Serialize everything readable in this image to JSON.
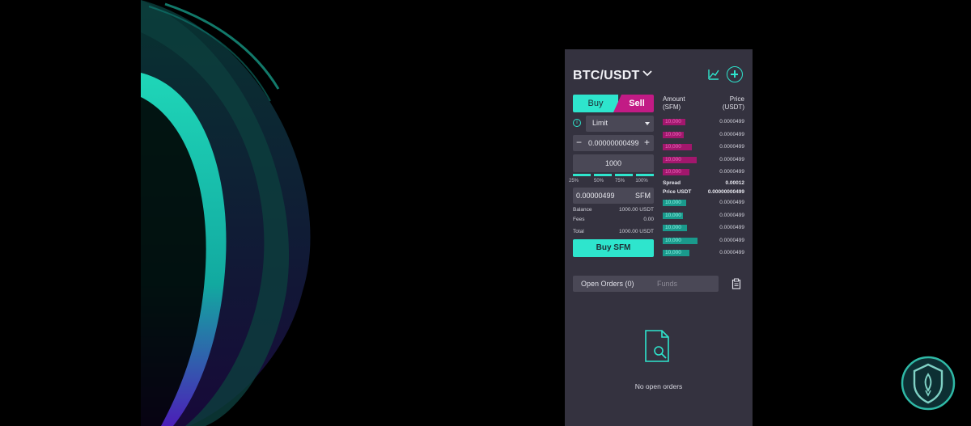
{
  "trade": {
    "pair": "BTC/USDT",
    "tabs": {
      "buy": "Buy",
      "sell": "Sell"
    },
    "order_type": "Limit",
    "price_value": "0.00000000499",
    "quantity_value": "1000",
    "percent_options": [
      "25%",
      "50%",
      "75%",
      "100%"
    ],
    "total_value": "0.00000499",
    "total_unit": "SFM",
    "balance_label": "Balance",
    "balance_value": "1000.00 USDT",
    "fees_label": "Fees",
    "fees_value": "0.00",
    "total_label": "Total",
    "total_amount": "1000.00 USDT",
    "buy_button": "Buy SFM"
  },
  "orderbook": {
    "amount_header": [
      "Amount",
      "(SFM)"
    ],
    "price_header": [
      "Price",
      "(USDT)"
    ],
    "asks": [
      {
        "amount": "10,000",
        "price": "0.0000499",
        "depth": 0.28
      },
      {
        "amount": "10,000",
        "price": "0.0000499",
        "depth": 0.26
      },
      {
        "amount": "10,000",
        "price": "0.0000499",
        "depth": 0.36
      },
      {
        "amount": "10,000",
        "price": "0.0000499",
        "depth": 0.42
      },
      {
        "amount": "10,000",
        "price": "0.0000499",
        "depth": 0.33
      }
    ],
    "spread_label": "Spread",
    "spread_value": "0.00012",
    "price_usdt_label": "Price USDT",
    "price_usdt_value": "0.00000000499",
    "bids": [
      {
        "amount": "10,000",
        "price": "0.0000499",
        "depth": 0.29
      },
      {
        "amount": "10,000",
        "price": "0.0000499",
        "depth": 0.25
      },
      {
        "amount": "10,000",
        "price": "0.0000499",
        "depth": 0.3
      },
      {
        "amount": "10,000",
        "price": "0.0000499",
        "depth": 0.43
      },
      {
        "amount": "10,000",
        "price": "0.0000499",
        "depth": 0.33
      }
    ]
  },
  "orders": {
    "open_tab": "Open Orders (0)",
    "funds_tab": "Funds",
    "empty_text": "No open orders"
  },
  "colors": {
    "accent": "#2ee5cd",
    "sell": "#c21b85",
    "ask_bar": "#a2176d",
    "bid_bar": "#1a9a8c",
    "panel": "#34323f"
  }
}
